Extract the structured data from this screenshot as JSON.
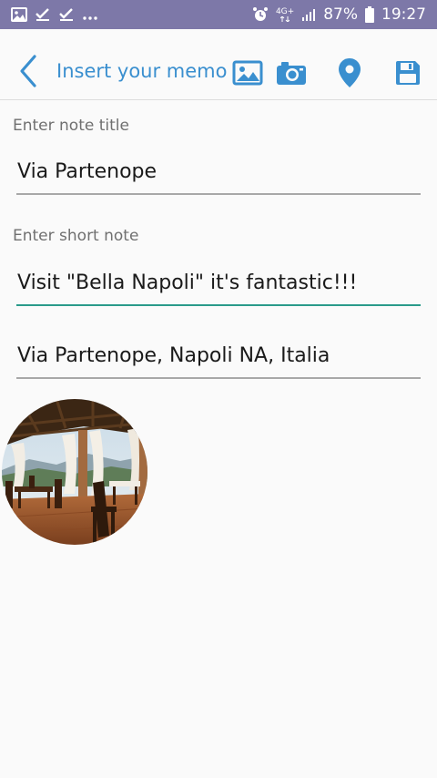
{
  "status_bar": {
    "network": "4G+",
    "battery": "87%",
    "time": "19:27",
    "icons": [
      "image-icon",
      "check-icon",
      "check-icon",
      "more-icon",
      "alarm-icon",
      "signal-icon",
      "battery-icon"
    ]
  },
  "toolbar": {
    "title": "Insert your memo",
    "accent_color": "#3a8fcf",
    "icons": [
      "back-arrow-icon",
      "image-icon",
      "camera-icon",
      "location-pin-icon",
      "save-icon"
    ]
  },
  "form": {
    "title_label": "Enter note title",
    "title_value": "Via Partenope",
    "note_label": "Enter short note",
    "note_value": "Visit \"Bella Napoli\" it's fantastic!!!",
    "address_value": "Via Partenope, Napoli NA, Italia",
    "focus_color": "#2a9a8a"
  }
}
